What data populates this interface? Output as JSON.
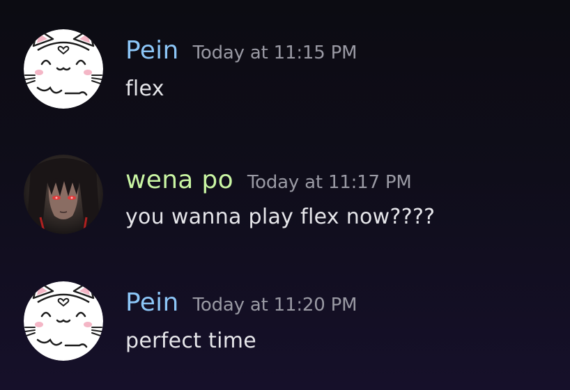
{
  "colors": {
    "username_pein": "#8cc6f7",
    "username_wena": "#c9f5a3",
    "timestamp": "#9a9aa4",
    "message_text": "#e6e6ea"
  },
  "messages": [
    {
      "author": "Pein",
      "author_color": "#8cc6f7",
      "avatar_icon": "white-cat-avatar-icon",
      "timestamp": "Today at 11:15 PM",
      "text": "flex"
    },
    {
      "author": "wena po",
      "author_color": "#c9f5a3",
      "avatar_icon": "dark-anime-girl-avatar-icon",
      "timestamp": "Today at 11:17 PM",
      "text": "you wanna play flex now????"
    },
    {
      "author": "Pein",
      "author_color": "#8cc6f7",
      "avatar_icon": "white-cat-avatar-icon",
      "timestamp": "Today at 11:20 PM",
      "text": "perfect time"
    }
  ]
}
